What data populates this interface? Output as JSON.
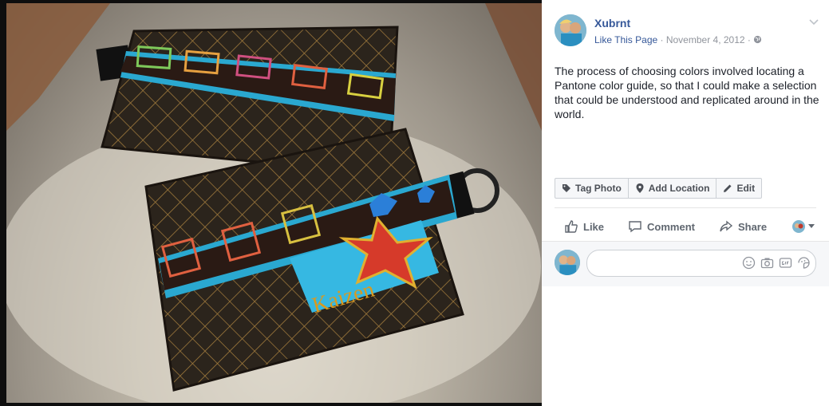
{
  "post": {
    "page_name": "Xubrnt",
    "like_page": "Like This Page",
    "date": "November 4, 2012",
    "separator": " · ",
    "caption": "The process of choosing colors involved locating a Pantone color guide, so that I could make a selection that could be understood and replicated around in the world."
  },
  "photo": {
    "label_text": "Kaizen"
  },
  "photo_actions": [
    {
      "label": "Tag Photo",
      "icon": "tag-icon"
    },
    {
      "label": "Add Location",
      "icon": "location-pin-icon"
    },
    {
      "label": "Edit",
      "icon": "pencil-icon"
    }
  ],
  "ufi": {
    "like": "Like",
    "comment": "Comment",
    "share": "Share"
  },
  "colors": {
    "link": "#365899",
    "meta_gray": "#90949c",
    "text": "#1d2129"
  }
}
